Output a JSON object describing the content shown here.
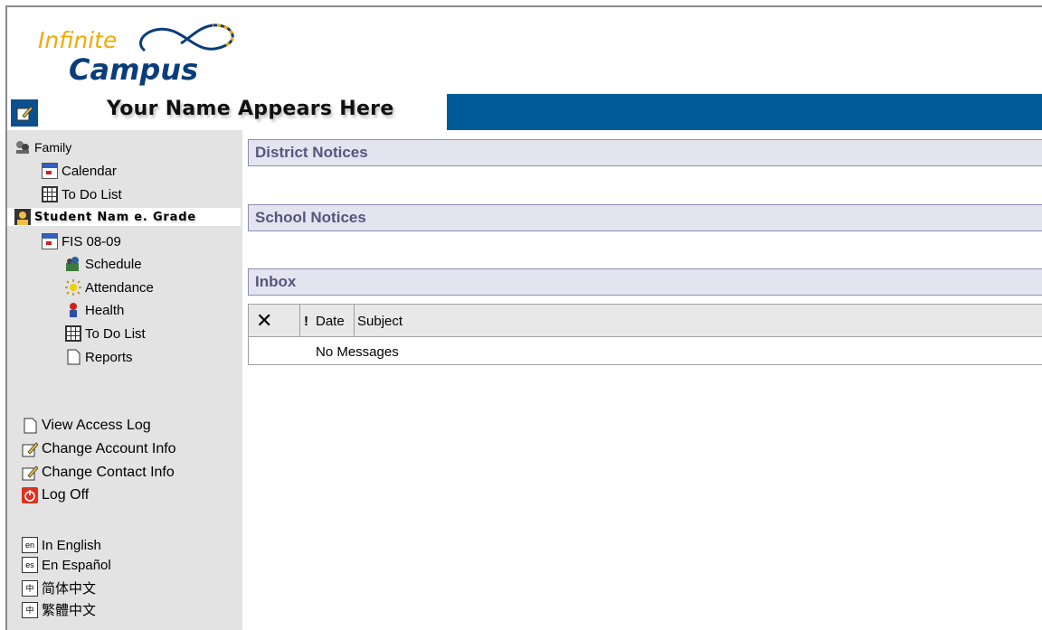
{
  "header": {
    "logo_word1": "Infinite",
    "logo_word2": "Campus",
    "user_title": "Your Name Appears Here"
  },
  "sidebar": {
    "family": "Family",
    "calendar": "Calendar",
    "todo": "To Do List",
    "student": "Student Nam e. Grade",
    "term": "FIS 08-09",
    "schedule": "Schedule",
    "attendance": "Attendance",
    "health": "Health",
    "todo2": "To Do List",
    "reports": "Reports",
    "view_log": "View Access Log",
    "change_account": "Change Account Info",
    "change_contact": "Change Contact Info",
    "logoff": "Log Off",
    "lang_en_code": "en",
    "lang_en": "In English",
    "lang_es_code": "es",
    "lang_es": "En Español",
    "lang_zh_code": "中",
    "lang_zh_s": "简体中文",
    "lang_zh_t": "繁體中文"
  },
  "main": {
    "district_notices": "District Notices",
    "school_notices": "School Notices",
    "inbox": "Inbox",
    "inbox_columns": {
      "delete": "✕",
      "priority": "!",
      "date": "Date",
      "subject": "Subject"
    },
    "empty_message": "No Messages"
  },
  "colors": {
    "brand_blue": "#005a97",
    "logo_orange": "#f2a900",
    "logo_navy": "#0a3d7a",
    "section_text": "#55557f"
  }
}
